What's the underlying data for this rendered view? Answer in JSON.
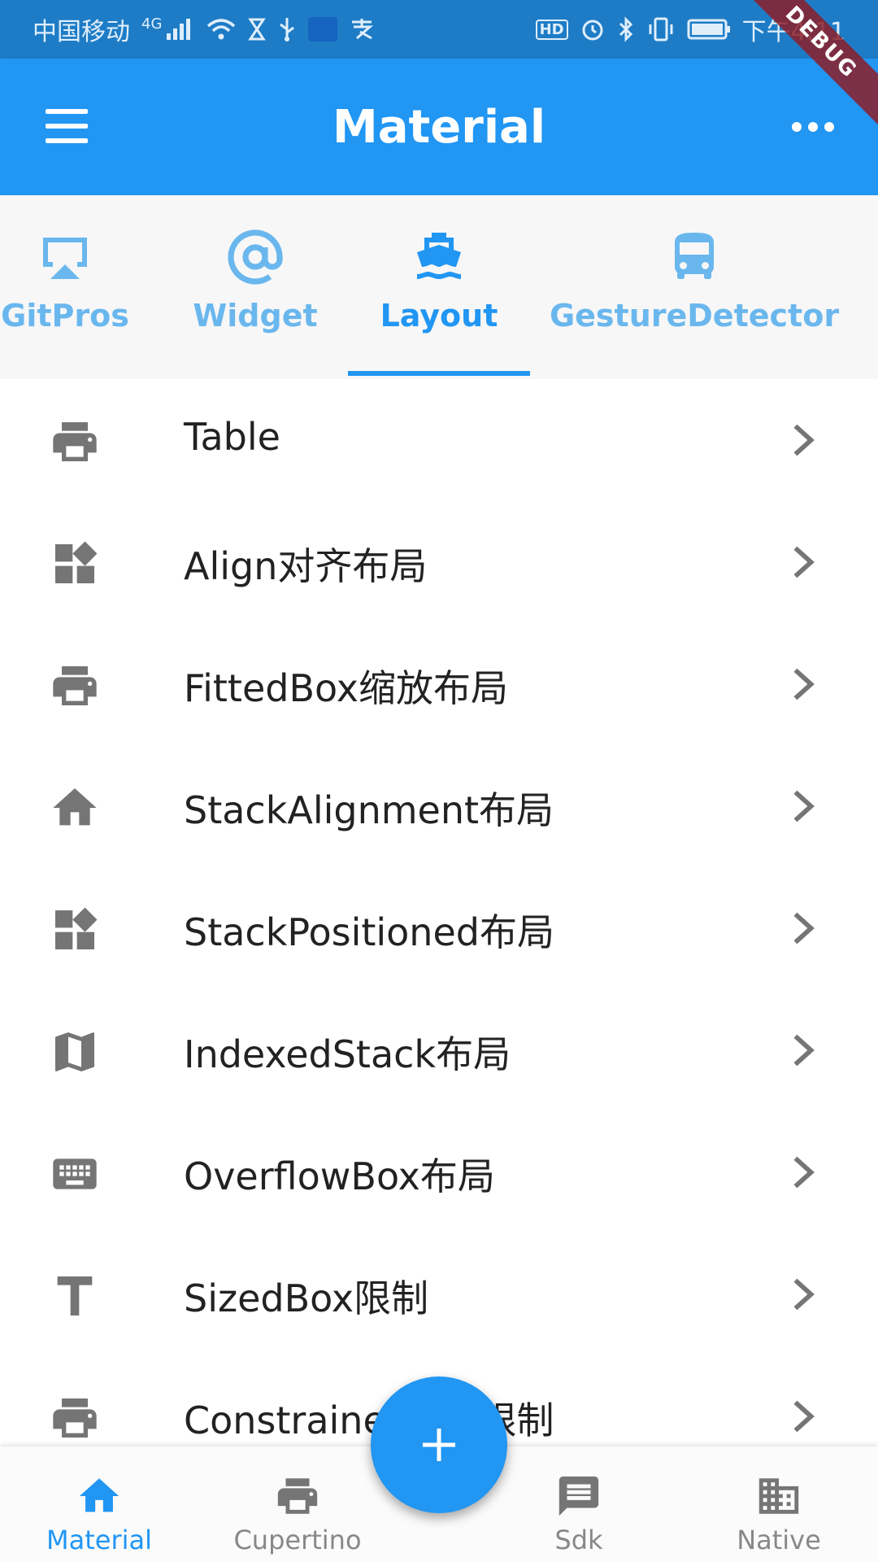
{
  "status_bar": {
    "carrier": "中国移动",
    "network": "4G",
    "time": "下午4:11",
    "hd_badge": "HD",
    "icons": [
      "signal-icon",
      "wifi-icon",
      "hourglass-icon",
      "usb-icon",
      "app-icon",
      "alipay-icon",
      "alarm-icon",
      "bluetooth-icon",
      "vibrate-icon",
      "battery-icon"
    ]
  },
  "debug_banner": "DEBUG",
  "app_bar": {
    "title": "Material",
    "menu_icon": "menu-icon",
    "more_icon": "more-horiz-icon"
  },
  "tabs": [
    {
      "label": "GitPros",
      "icon": "airplay-icon",
      "active": false
    },
    {
      "label": "Widget",
      "icon": "at-sign-icon",
      "active": false
    },
    {
      "label": "Layout",
      "icon": "ship-icon",
      "active": true
    },
    {
      "label": "GestureDetector",
      "icon": "bus-icon",
      "active": false
    }
  ],
  "list": {
    "items": [
      {
        "label": "Table",
        "icon": "print-icon"
      },
      {
        "label": "Align对齐布局",
        "icon": "widgets-icon"
      },
      {
        "label": "FittedBox缩放布局",
        "icon": "print-icon"
      },
      {
        "label": "StackAlignment布局",
        "icon": "home-icon"
      },
      {
        "label": "StackPositioned布局",
        "icon": "widgets-icon"
      },
      {
        "label": "IndexedStack布局",
        "icon": "map-icon"
      },
      {
        "label": "OverflowBox布局",
        "icon": "keyboard-icon"
      },
      {
        "label": "SizedBox限制",
        "icon": "text-icon"
      },
      {
        "label": "ConstrainedBox限制",
        "icon": "print-icon"
      }
    ]
  },
  "fab": {
    "icon": "add-icon"
  },
  "bottom_nav": [
    {
      "label": "Material",
      "icon": "home-icon",
      "active": true
    },
    {
      "label": "Cupertino",
      "icon": "print-icon",
      "active": false
    },
    {
      "label": "Sdk",
      "icon": "message-icon",
      "active": false
    },
    {
      "label": "Native",
      "icon": "business-icon",
      "active": false
    }
  ],
  "colors": {
    "primary": "#2196F3",
    "status_bar": "#1E7CC6",
    "tab_inactive": "#6AB7EE",
    "icon_grey": "#757575",
    "nav_inactive": "#888888"
  }
}
